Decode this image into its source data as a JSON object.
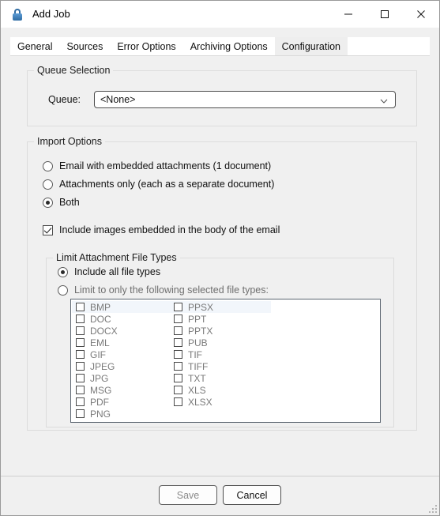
{
  "window": {
    "title": "Add Job",
    "icon": "lock-icon",
    "controls": {
      "minimize": "minimize-icon",
      "maximize": "maximize-icon",
      "close": "close-icon"
    }
  },
  "tabs": [
    {
      "label": "General",
      "active": false
    },
    {
      "label": "Sources",
      "active": false
    },
    {
      "label": "Error Options",
      "active": false
    },
    {
      "label": "Archiving Options",
      "active": false
    },
    {
      "label": "Configuration",
      "active": true
    }
  ],
  "queue_selection": {
    "legend": "Queue Selection",
    "queue_label": "Queue:",
    "queue_value": "<None>",
    "queue_placeholder": "<None>",
    "arrow_icon": "chevron-down-icon"
  },
  "import_options": {
    "legend": "Import Options",
    "radios": [
      {
        "label": "Email with embedded attachments (1 document)",
        "checked": false
      },
      {
        "label": "Attachments only (each as a separate document)",
        "checked": false
      },
      {
        "label": "Both",
        "checked": true
      }
    ],
    "include_images": {
      "label": "Include images embedded in the body of the email",
      "checked": true
    }
  },
  "limit_attachment_file_types": {
    "legend": "Limit Attachment File Types",
    "radios": [
      {
        "label": "Include all file types",
        "checked": true
      },
      {
        "label": "Limit to only the following selected file types:",
        "checked": false
      }
    ],
    "file_types_left": [
      {
        "label": "BMP",
        "checked": false,
        "focused": true
      },
      {
        "label": "DOC",
        "checked": false,
        "focused": false
      },
      {
        "label": "DOCX",
        "checked": false,
        "focused": false
      },
      {
        "label": "EML",
        "checked": false,
        "focused": false
      },
      {
        "label": "GIF",
        "checked": false,
        "focused": false
      },
      {
        "label": "JPEG",
        "checked": false,
        "focused": false
      },
      {
        "label": "JPG",
        "checked": false,
        "focused": false
      },
      {
        "label": "MSG",
        "checked": false,
        "focused": false
      },
      {
        "label": "PDF",
        "checked": false,
        "focused": false
      },
      {
        "label": "PNG",
        "checked": false,
        "focused": false
      }
    ],
    "file_types_right": [
      {
        "label": "PPSX",
        "checked": false,
        "focused": false
      },
      {
        "label": "PPT",
        "checked": false,
        "focused": false
      },
      {
        "label": "PPTX",
        "checked": false,
        "focused": false
      },
      {
        "label": "PUB",
        "checked": false,
        "focused": false
      },
      {
        "label": "TIF",
        "checked": false,
        "focused": false
      },
      {
        "label": "TIFF",
        "checked": false,
        "focused": false
      },
      {
        "label": "TXT",
        "checked": false,
        "focused": false
      },
      {
        "label": "XLS",
        "checked": false,
        "focused": false
      },
      {
        "label": "XLSX",
        "checked": false,
        "focused": false
      }
    ]
  },
  "footer": {
    "save_label": "Save",
    "save_disabled": true,
    "cancel_label": "Cancel",
    "resize_grip": "resize-grip-icon"
  },
  "colors": {
    "dialog_bg": "#f0f0f0",
    "titlebar_bg": "#ffffff",
    "active_tab_bg": "#eeeeee",
    "lock_icon": "#2f6ca3",
    "list_focus_row": "#f2f6fb",
    "disabled_text": "#7a7a7a"
  }
}
